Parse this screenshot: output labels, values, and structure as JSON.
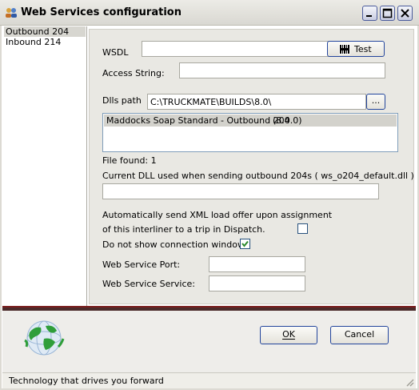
{
  "window": {
    "title": "Web Services configuration",
    "icon": "people-icon",
    "controls": [
      "minimize",
      "maximize",
      "close"
    ]
  },
  "sidebar": {
    "items": [
      {
        "label": "Outbound 204",
        "selected": true
      },
      {
        "label": "Inbound 214",
        "selected": false
      }
    ]
  },
  "form": {
    "wsdl_label": "WSDL",
    "wsdl_value": "",
    "test_button": "Test",
    "access_label": "Access String:",
    "access_value": "",
    "dlls_label": "Dlls path",
    "dlls_value": "C:\\TRUCKMATE\\BUILDS\\8.0\\",
    "browse_button": "...",
    "dll_list": [
      {
        "name": "Maddocks Soap Standard - Outbound 204",
        "version": "(8.0.0)",
        "selected": true
      }
    ],
    "files_found": "File found: 1",
    "current_dll_label": "Current DLL used when sending outbound 204s ( ws_o204_default.dll )",
    "current_dll_value": "",
    "auto_send_label_line1": "Automatically send XML load offer upon assignment",
    "auto_send_label_line2": "of this interliner to a trip in Dispatch.",
    "auto_send_checked": false,
    "no_conn_label": "Do not show connection window",
    "no_conn_checked": true,
    "port_label": "Web Service Port:",
    "port_value": "",
    "service_label": "Web Service Service:",
    "service_value": ""
  },
  "buttons": {
    "ok": "OK",
    "cancel": "Cancel"
  },
  "logo": "globe-icon",
  "status": {
    "text": "Technology that drives you forward"
  },
  "colors": {
    "accent_border": "#23459c",
    "separator": "#7b1f1f",
    "check": "#2c8a2c"
  }
}
